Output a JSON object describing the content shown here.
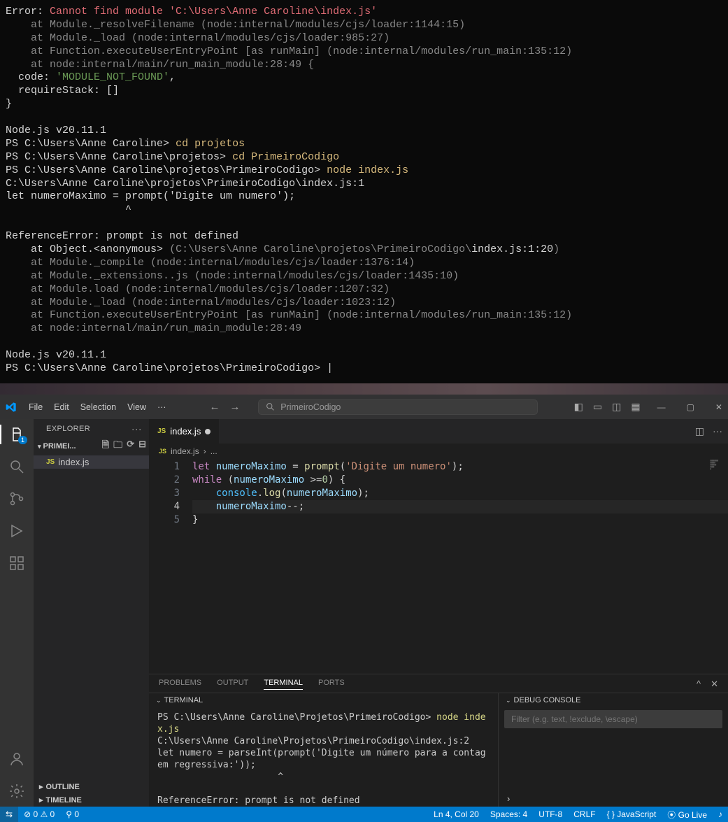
{
  "terminal_top": {
    "error_head": "Error:",
    "error_msg": "Cannot find module 'C:\\Users\\Anne Caroline\\index.js'",
    "stack1": "    at Module._resolveFilename (node:internal/modules/cjs/loader:1144:15)",
    "stack2": "    at Module._load (node:internal/modules/cjs/loader:985:27)",
    "stack3": "    at Function.executeUserEntryPoint [as runMain] (node:internal/modules/run_main:135:12)",
    "stack4": "    at node:internal/main/run_main_module:28:49 {",
    "code_lbl": "  code: ",
    "code_val": "'MODULE_NOT_FOUND'",
    "comma": ",",
    "req": "  requireStack: []",
    "brace": "}",
    "node_v": "Node.js v20.11.1",
    "ps1a": "PS C:\\Users\\Anne Caroline>",
    "cmd1": "cd projetos",
    "ps1b": "PS C:\\Users\\Anne Caroline\\projetos>",
    "cmd2": "cd PrimeiroCodigo",
    "ps1c": "PS C:\\Users\\Anne Caroline\\projetos\\PrimeiroCodigo>",
    "cmd3": "node index.js",
    "errfile": "C:\\Users\\Anne Caroline\\projetos\\PrimeiroCodigo\\index.js:1",
    "errline": "let numeroMaximo = prompt('Digite um numero');",
    "caret": "                   ^",
    "refhead": "ReferenceError: prompt is not defined",
    "ref1a": "    at Object.<anonymous>",
    "ref1b": "(C:\\Users\\Anne Caroline\\projetos\\PrimeiroCodigo\\",
    "ref1c": "index.js:1:20",
    "ref1d": ")",
    "ref2": "    at Module._compile (node:internal/modules/cjs/loader:1376:14)",
    "ref3": "    at Module._extensions..js (node:internal/modules/cjs/loader:1435:10)",
    "ref4": "    at Module.load (node:internal/modules/cjs/loader:1207:32)",
    "ref5": "    at Module._load (node:internal/modules/cjs/loader:1023:12)",
    "ref6": "    at Function.executeUserEntryPoint [as runMain] (node:internal/modules/run_main:135:12)",
    "ref7": "    at node:internal/main/run_main_module:28:49",
    "ps1d": "PS C:\\Users\\Anne Caroline\\projetos\\PrimeiroCodigo>",
    "cursor": "|"
  },
  "vsc": {
    "menu": [
      "File",
      "Edit",
      "Selection",
      "View"
    ],
    "menu_more": "···",
    "search_placeholder": "PrimeiroCodigo",
    "explorer_title": "EXPLORER",
    "more": "···",
    "project": "PRIMEI...",
    "file": "index.js",
    "outline": "OUTLINE",
    "timeline": "TIMELINE",
    "tab": "index.js",
    "crumb_sep": "›",
    "crumb_more": "...",
    "lines": [
      "1",
      "2",
      "3",
      "4",
      "5"
    ],
    "panel_tabs": [
      "PROBLEMS",
      "OUTPUT",
      "TERMINAL",
      "PORTS"
    ],
    "terminal_label": "TERMINAL",
    "debug_label": "DEBUG CONSOLE",
    "term_ps": "PS C:\\Users\\Anne Caroline\\Projetos\\PrimeiroCodigo> ",
    "term_cmd": "node index.js",
    "term_l2": "C:\\Users\\Anne Caroline\\Projetos\\PrimeiroCodigo\\index.js:2",
    "term_l3": "let numero = parseInt(prompt('Digite um número para a contagem regressiva:'));",
    "term_caret": "                      ^",
    "term_l5": "ReferenceError: prompt is not defined",
    "dbg_filter": "Filter (e.g. text, !exclude, \\escape)",
    "dbg_prompt": "›",
    "status": {
      "remote": "⇆",
      "err": "⊘ 0 ⚠ 0",
      "port": "⚲ 0",
      "cursor": "Ln 4, Col 20",
      "spaces": "Spaces: 4",
      "enc": "UTF-8",
      "eol": "CRLF",
      "lang": "{ } JavaScript",
      "golive": "⦿ Go Live",
      "bell": "♪"
    },
    "explorer_badge": "1"
  },
  "code": {
    "l1_let": "let ",
    "l1_var": "numeroMaximo",
    "l1_eq": " = ",
    "l1_fn": "prompt",
    "l1_op": "(",
    "l1_str": "'Digite um numero'",
    "l1_cl": ");",
    "l2_kw": "while ",
    "l2_op": "(",
    "l2_var": "numeroMaximo",
    "l2_cmp": " >=",
    "l2_num": "0",
    "l2_cl": ") {",
    "l3_ind": "    ",
    "l3_obj": "console",
    "l3_dot": ".",
    "l3_fn": "log",
    "l3_op": "(",
    "l3_var": "numeroMaximo",
    "l3_cl": ");",
    "l4_ind": "    ",
    "l4_var": "numeroMaximo",
    "l4_op": "--;",
    "l5": "}"
  }
}
